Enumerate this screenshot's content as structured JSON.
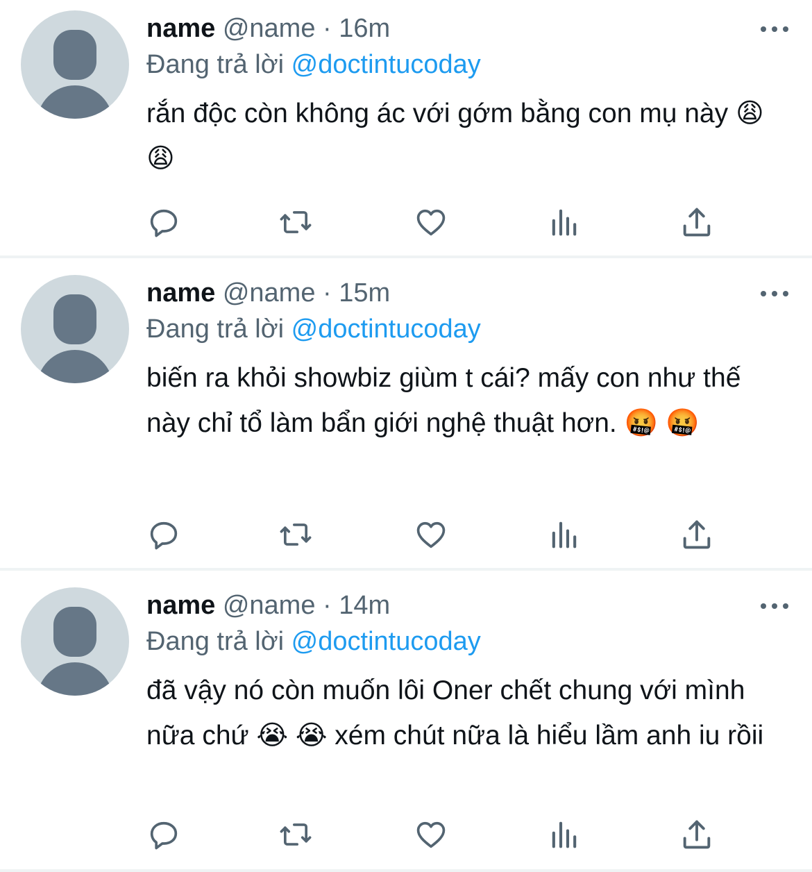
{
  "tweets": [
    {
      "name": "name",
      "handle": "@name",
      "separator": "·",
      "time": "16m",
      "replying_prefix": "Đang trả lời",
      "replying_to": "@doctintucoday",
      "text": "rắn độc còn không ác với gớm bằng con mụ này 😩 😩"
    },
    {
      "name": "name",
      "handle": "@name",
      "separator": "·",
      "time": "15m",
      "replying_prefix": "Đang trả lời",
      "replying_to": "@doctintucoday",
      "text": "biến ra khỏi showbiz giùm t cái? mấy con như thế này chỉ tổ làm bẩn giới nghệ thuật hơn. 🤬 🤬"
    },
    {
      "name": "name",
      "handle": "@name",
      "separator": "·",
      "time": "14m",
      "replying_prefix": "Đang trả lời",
      "replying_to": "@doctintucoday",
      "text": "đã vậy nó còn muốn lôi Oner chết chung với mình nữa chứ 😭 😭  xém chút nữa là hiểu lầm anh iu rồii"
    }
  ],
  "icons": {
    "reply": "reply-icon",
    "retweet": "retweet-icon",
    "like": "heart-icon",
    "views": "analytics-icon",
    "share": "share-icon",
    "more": "more-icon"
  },
  "colors": {
    "text": "#0f1419",
    "secondary": "#536471",
    "link": "#1d9bf0",
    "avatar_bg": "#cfd9de",
    "avatar_fg": "#667787",
    "divider": "#eff3f4"
  }
}
